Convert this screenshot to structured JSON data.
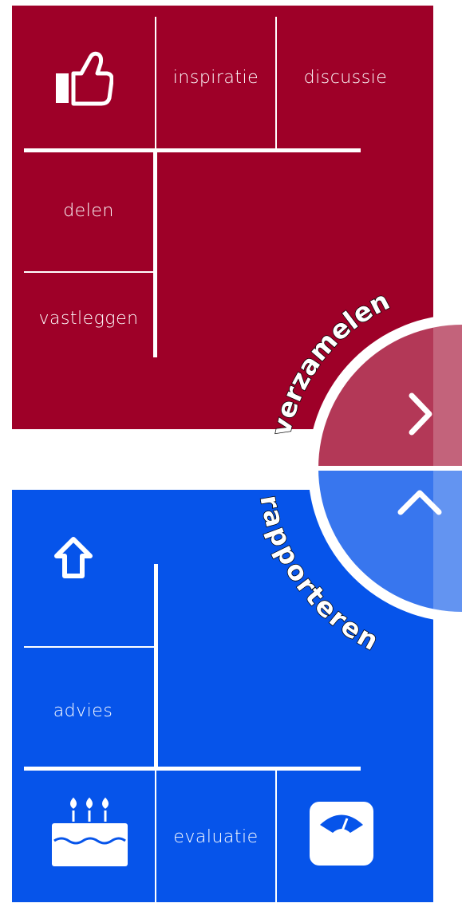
{
  "top_panel": {
    "color": "#9e0028",
    "icon": "thumbs-up-icon",
    "items": [
      "inspiratie",
      "discussie",
      "delen",
      "vastleggen"
    ]
  },
  "bottom_panel": {
    "color": "#0654ea",
    "icons": [
      "upload-arrow-icon",
      "birthday-cake-icon",
      "scale-icon"
    ],
    "items": [
      "advies",
      "evaluatie"
    ]
  },
  "wheel": {
    "top_label": "verzamelen",
    "bottom_label": "rapporteren",
    "top_button_icon": "chevron-right-icon",
    "bottom_button_icon": "chevron-up-icon"
  }
}
